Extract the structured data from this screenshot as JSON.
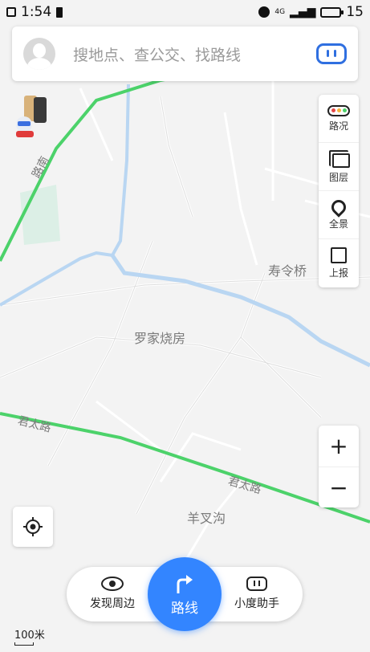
{
  "status_bar": {
    "time": "1:54",
    "network": "4G",
    "battery": "15"
  },
  "search": {
    "placeholder": "搜地点、查公交、找路线"
  },
  "map": {
    "labels": {
      "poi_1": "寿令桥",
      "poi_2": "罗家烧房",
      "poi_3": "羊叉沟",
      "road_1": "君太路",
      "road_2": "君太路",
      "road_3": "路南"
    }
  },
  "tools": {
    "traffic": "路况",
    "layers": "图层",
    "panorama": "全景",
    "report": "上报"
  },
  "zoom": {
    "in": "+",
    "out": "−"
  },
  "bottom": {
    "nearby": "发现周边",
    "route": "路线",
    "assistant": "小度助手"
  },
  "scale": "100米",
  "colors": {
    "accent": "#3385ff",
    "road_green": "#4cd26a",
    "river": "#b9d6f2"
  }
}
